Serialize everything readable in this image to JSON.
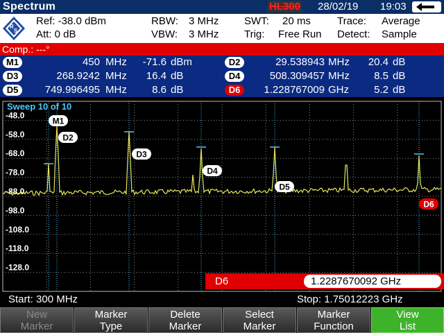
{
  "header": {
    "title": "Spectrum",
    "status_code": "HL300",
    "date": "28/02/19",
    "time": "19:03"
  },
  "settings": {
    "ref": "Ref: -38.0 dBm",
    "att": "Att: 0 dB",
    "rbw_label": "RBW:",
    "rbw_value": "3 MHz",
    "vbw_label": "VBW:",
    "vbw_value": "3 MHz",
    "swt_label": "SWT:",
    "swt_value": "20 ms",
    "trig_label": "Trig:",
    "trig_value": "Free Run",
    "trace_label": "Trace:",
    "trace_value": "Average",
    "detect_label": "Detect:",
    "detect_value": "Sample"
  },
  "comp": "Comp.: ---°",
  "markers": [
    {
      "id": "M1",
      "freq": "450",
      "freq_unit": "MHz",
      "level": "-71.6",
      "level_unit": "dBm"
    },
    {
      "id": "D2",
      "freq": "29.538943",
      "freq_unit": "MHz",
      "level": "20.4",
      "level_unit": "dB"
    },
    {
      "id": "D3",
      "freq": "268.9242",
      "freq_unit": "MHz",
      "level": "16.4",
      "level_unit": "dB"
    },
    {
      "id": "D4",
      "freq": "508.309457",
      "freq_unit": "MHz",
      "level": "8.5",
      "level_unit": "dB"
    },
    {
      "id": "D5",
      "freq": "749.996495",
      "freq_unit": "MHz",
      "level": "8.6",
      "level_unit": "dB"
    },
    {
      "id": "D6",
      "freq": "1.228767009",
      "freq_unit": "GHz",
      "level": "5.2",
      "level_unit": "dB"
    }
  ],
  "plot": {
    "sweep_label": "Sweep 10 of 10",
    "y_ticks": [
      "-48.0",
      "-58.0",
      "-68.0",
      "-78.0",
      "-88.0",
      "-98.0",
      "-108.0",
      "-118.0",
      "-128.0"
    ],
    "trace_color": "#e8e85a",
    "marker_line_color": "#4fc7ff",
    "grid_color": "#8a8a8a"
  },
  "marker_entry": {
    "label": "D6",
    "value": "1.2287670092 GHz"
  },
  "span": {
    "start": "Start:  300 MHz",
    "stop": "Stop: 1.75012223 GHz"
  },
  "softkeys": [
    {
      "line1": "New",
      "line2": "Marker",
      "state": "disabled"
    },
    {
      "line1": "Marker",
      "line2": "Type",
      "state": "normal"
    },
    {
      "line1": "Delete",
      "line2": "Marker",
      "state": "normal"
    },
    {
      "line1": "Select",
      "line2": "Marker",
      "state": "normal"
    },
    {
      "line1": "Marker",
      "line2": "Function",
      "state": "normal"
    },
    {
      "line1": "View",
      "line2": "List",
      "state": "active"
    }
  ]
}
